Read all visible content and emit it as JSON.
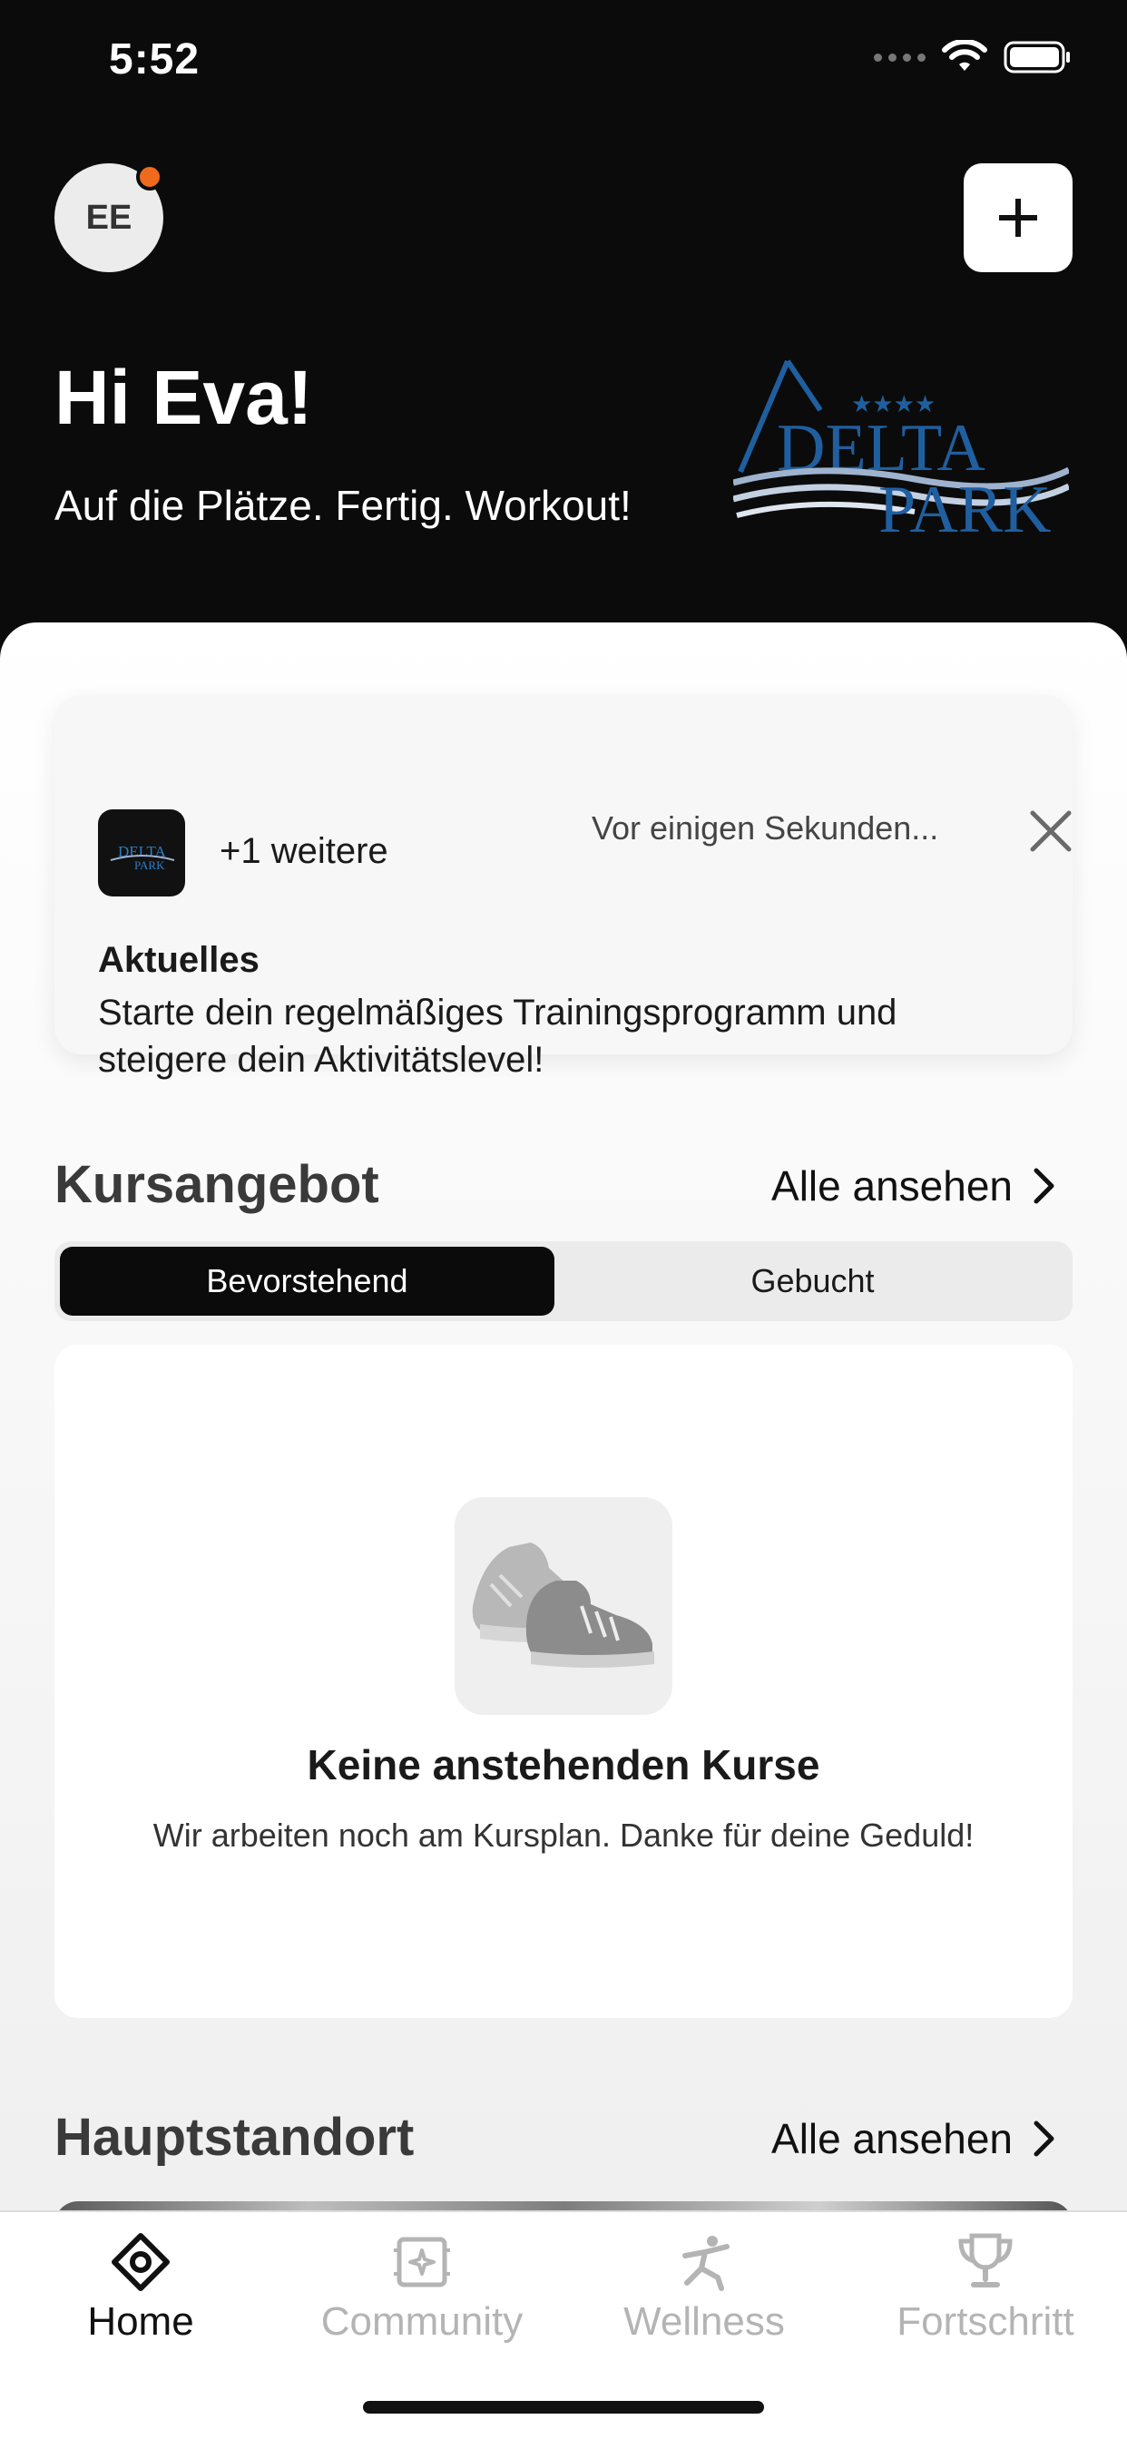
{
  "status_bar": {
    "time": "5:52"
  },
  "header": {
    "avatar_initials": "EE",
    "greeting": "Hi Eva!",
    "tagline": "Auf die Plätze. Fertig. Workout!",
    "logo": {
      "line1": "DELTA",
      "line2": "PARK"
    }
  },
  "notification": {
    "more": "+1 weitere",
    "time": "Vor einigen Sekunden...",
    "title": "Aktuelles",
    "body": "Starte dein regelmäßiges Trainingsprogramm und steigere dein Aktivitätslevel!"
  },
  "courses": {
    "title": "Kursangebot",
    "see_all": "Alle ansehen",
    "tabs": [
      {
        "label": "Bevorstehend",
        "active": true
      },
      {
        "label": "Gebucht",
        "active": false
      }
    ],
    "empty": {
      "title": "Keine anstehenden Kurse",
      "subtitle": "Wir arbeiten noch am Kursplan. Danke für deine Geduld!"
    }
  },
  "location": {
    "title": "Hauptstandort",
    "see_all": "Alle ansehen"
  },
  "tabbar": {
    "items": [
      {
        "label": "Home",
        "icon": "home-icon",
        "active": true
      },
      {
        "label": "Community",
        "icon": "community-icon",
        "active": false
      },
      {
        "label": "Wellness",
        "icon": "wellness-icon",
        "active": false
      },
      {
        "label": "Fortschritt",
        "icon": "trophy-icon",
        "active": false
      }
    ]
  },
  "colors": {
    "header_bg": "#0b0b0b",
    "badge": "#ef6a1d",
    "logo_blue": "#1f5fa0",
    "inactive_tab": "#b4b4b4"
  }
}
